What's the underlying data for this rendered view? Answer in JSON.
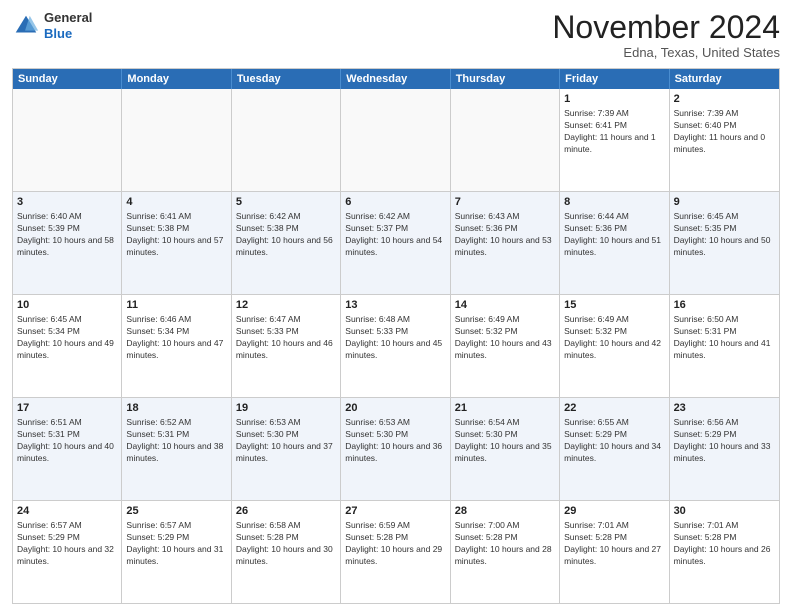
{
  "header": {
    "logo": {
      "general": "General",
      "blue": "Blue"
    },
    "month_title": "November 2024",
    "location": "Edna, Texas, United States"
  },
  "days_of_week": [
    "Sunday",
    "Monday",
    "Tuesday",
    "Wednesday",
    "Thursday",
    "Friday",
    "Saturday"
  ],
  "weeks": [
    {
      "id": "week1",
      "cells": [
        {
          "day": "",
          "empty": true
        },
        {
          "day": "",
          "empty": true
        },
        {
          "day": "",
          "empty": true
        },
        {
          "day": "",
          "empty": true
        },
        {
          "day": "",
          "empty": true
        },
        {
          "day": "1",
          "sunrise": "Sunrise: 7:39 AM",
          "sunset": "Sunset: 6:41 PM",
          "daylight": "Daylight: 11 hours and 1 minute."
        },
        {
          "day": "2",
          "sunrise": "Sunrise: 7:39 AM",
          "sunset": "Sunset: 6:40 PM",
          "daylight": "Daylight: 11 hours and 0 minutes."
        }
      ]
    },
    {
      "id": "week2",
      "cells": [
        {
          "day": "3",
          "sunrise": "Sunrise: 6:40 AM",
          "sunset": "Sunset: 5:39 PM",
          "daylight": "Daylight: 10 hours and 58 minutes."
        },
        {
          "day": "4",
          "sunrise": "Sunrise: 6:41 AM",
          "sunset": "Sunset: 5:38 PM",
          "daylight": "Daylight: 10 hours and 57 minutes."
        },
        {
          "day": "5",
          "sunrise": "Sunrise: 6:42 AM",
          "sunset": "Sunset: 5:38 PM",
          "daylight": "Daylight: 10 hours and 56 minutes."
        },
        {
          "day": "6",
          "sunrise": "Sunrise: 6:42 AM",
          "sunset": "Sunset: 5:37 PM",
          "daylight": "Daylight: 10 hours and 54 minutes."
        },
        {
          "day": "7",
          "sunrise": "Sunrise: 6:43 AM",
          "sunset": "Sunset: 5:36 PM",
          "daylight": "Daylight: 10 hours and 53 minutes."
        },
        {
          "day": "8",
          "sunrise": "Sunrise: 6:44 AM",
          "sunset": "Sunset: 5:36 PM",
          "daylight": "Daylight: 10 hours and 51 minutes."
        },
        {
          "day": "9",
          "sunrise": "Sunrise: 6:45 AM",
          "sunset": "Sunset: 5:35 PM",
          "daylight": "Daylight: 10 hours and 50 minutes."
        }
      ]
    },
    {
      "id": "week3",
      "cells": [
        {
          "day": "10",
          "sunrise": "Sunrise: 6:45 AM",
          "sunset": "Sunset: 5:34 PM",
          "daylight": "Daylight: 10 hours and 49 minutes."
        },
        {
          "day": "11",
          "sunrise": "Sunrise: 6:46 AM",
          "sunset": "Sunset: 5:34 PM",
          "daylight": "Daylight: 10 hours and 47 minutes."
        },
        {
          "day": "12",
          "sunrise": "Sunrise: 6:47 AM",
          "sunset": "Sunset: 5:33 PM",
          "daylight": "Daylight: 10 hours and 46 minutes."
        },
        {
          "day": "13",
          "sunrise": "Sunrise: 6:48 AM",
          "sunset": "Sunset: 5:33 PM",
          "daylight": "Daylight: 10 hours and 45 minutes."
        },
        {
          "day": "14",
          "sunrise": "Sunrise: 6:49 AM",
          "sunset": "Sunset: 5:32 PM",
          "daylight": "Daylight: 10 hours and 43 minutes."
        },
        {
          "day": "15",
          "sunrise": "Sunrise: 6:49 AM",
          "sunset": "Sunset: 5:32 PM",
          "daylight": "Daylight: 10 hours and 42 minutes."
        },
        {
          "day": "16",
          "sunrise": "Sunrise: 6:50 AM",
          "sunset": "Sunset: 5:31 PM",
          "daylight": "Daylight: 10 hours and 41 minutes."
        }
      ]
    },
    {
      "id": "week4",
      "cells": [
        {
          "day": "17",
          "sunrise": "Sunrise: 6:51 AM",
          "sunset": "Sunset: 5:31 PM",
          "daylight": "Daylight: 10 hours and 40 minutes."
        },
        {
          "day": "18",
          "sunrise": "Sunrise: 6:52 AM",
          "sunset": "Sunset: 5:31 PM",
          "daylight": "Daylight: 10 hours and 38 minutes."
        },
        {
          "day": "19",
          "sunrise": "Sunrise: 6:53 AM",
          "sunset": "Sunset: 5:30 PM",
          "daylight": "Daylight: 10 hours and 37 minutes."
        },
        {
          "day": "20",
          "sunrise": "Sunrise: 6:53 AM",
          "sunset": "Sunset: 5:30 PM",
          "daylight": "Daylight: 10 hours and 36 minutes."
        },
        {
          "day": "21",
          "sunrise": "Sunrise: 6:54 AM",
          "sunset": "Sunset: 5:30 PM",
          "daylight": "Daylight: 10 hours and 35 minutes."
        },
        {
          "day": "22",
          "sunrise": "Sunrise: 6:55 AM",
          "sunset": "Sunset: 5:29 PM",
          "daylight": "Daylight: 10 hours and 34 minutes."
        },
        {
          "day": "23",
          "sunrise": "Sunrise: 6:56 AM",
          "sunset": "Sunset: 5:29 PM",
          "daylight": "Daylight: 10 hours and 33 minutes."
        }
      ]
    },
    {
      "id": "week5",
      "cells": [
        {
          "day": "24",
          "sunrise": "Sunrise: 6:57 AM",
          "sunset": "Sunset: 5:29 PM",
          "daylight": "Daylight: 10 hours and 32 minutes."
        },
        {
          "day": "25",
          "sunrise": "Sunrise: 6:57 AM",
          "sunset": "Sunset: 5:29 PM",
          "daylight": "Daylight: 10 hours and 31 minutes."
        },
        {
          "day": "26",
          "sunrise": "Sunrise: 6:58 AM",
          "sunset": "Sunset: 5:28 PM",
          "daylight": "Daylight: 10 hours and 30 minutes."
        },
        {
          "day": "27",
          "sunrise": "Sunrise: 6:59 AM",
          "sunset": "Sunset: 5:28 PM",
          "daylight": "Daylight: 10 hours and 29 minutes."
        },
        {
          "day": "28",
          "sunrise": "Sunrise: 7:00 AM",
          "sunset": "Sunset: 5:28 PM",
          "daylight": "Daylight: 10 hours and 28 minutes."
        },
        {
          "day": "29",
          "sunrise": "Sunrise: 7:01 AM",
          "sunset": "Sunset: 5:28 PM",
          "daylight": "Daylight: 10 hours and 27 minutes."
        },
        {
          "day": "30",
          "sunrise": "Sunrise: 7:01 AM",
          "sunset": "Sunset: 5:28 PM",
          "daylight": "Daylight: 10 hours and 26 minutes."
        }
      ]
    }
  ]
}
